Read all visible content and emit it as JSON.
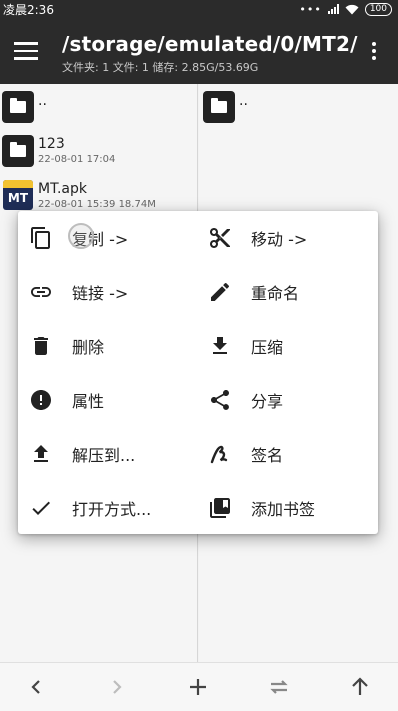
{
  "status_bar": {
    "time": "凌晨2:36",
    "battery": "100"
  },
  "toolbar": {
    "path": "/storage/emulated/0/MT2/",
    "info": "文件夹: 1  文件: 1  储存: 2.85G/53.69G"
  },
  "left_pane": {
    "items": [
      {
        "name": "..",
        "meta": ""
      },
      {
        "name": "123",
        "meta": "22-08-01 17:04"
      },
      {
        "name": "MT.apk",
        "meta": "22-08-01 15:39  18.74M",
        "icon_text": "MT"
      }
    ]
  },
  "right_pane": {
    "items": [
      {
        "name": ".."
      }
    ]
  },
  "context_menu": {
    "items": [
      {
        "label": "复制 ->",
        "icon": "copy-icon"
      },
      {
        "label": "移动 ->",
        "icon": "scissors-icon"
      },
      {
        "label": "链接 ->",
        "icon": "link-icon"
      },
      {
        "label": "重命名",
        "icon": "pencil-icon"
      },
      {
        "label": "删除",
        "icon": "trash-icon"
      },
      {
        "label": "压缩",
        "icon": "download-icon"
      },
      {
        "label": "属性",
        "icon": "info-alert-icon"
      },
      {
        "label": "分享",
        "icon": "share-icon"
      },
      {
        "label": "解压到...",
        "icon": "upload-icon"
      },
      {
        "label": "签名",
        "icon": "signature-icon"
      },
      {
        "label": "打开方式...",
        "icon": "check-icon"
      },
      {
        "label": "添加书签",
        "icon": "bookmark-add-icon"
      }
    ]
  },
  "bottom_bar": {
    "buttons": [
      "back-icon",
      "forward-icon",
      "plus-icon",
      "swap-icon",
      "up-arrow-icon"
    ]
  }
}
